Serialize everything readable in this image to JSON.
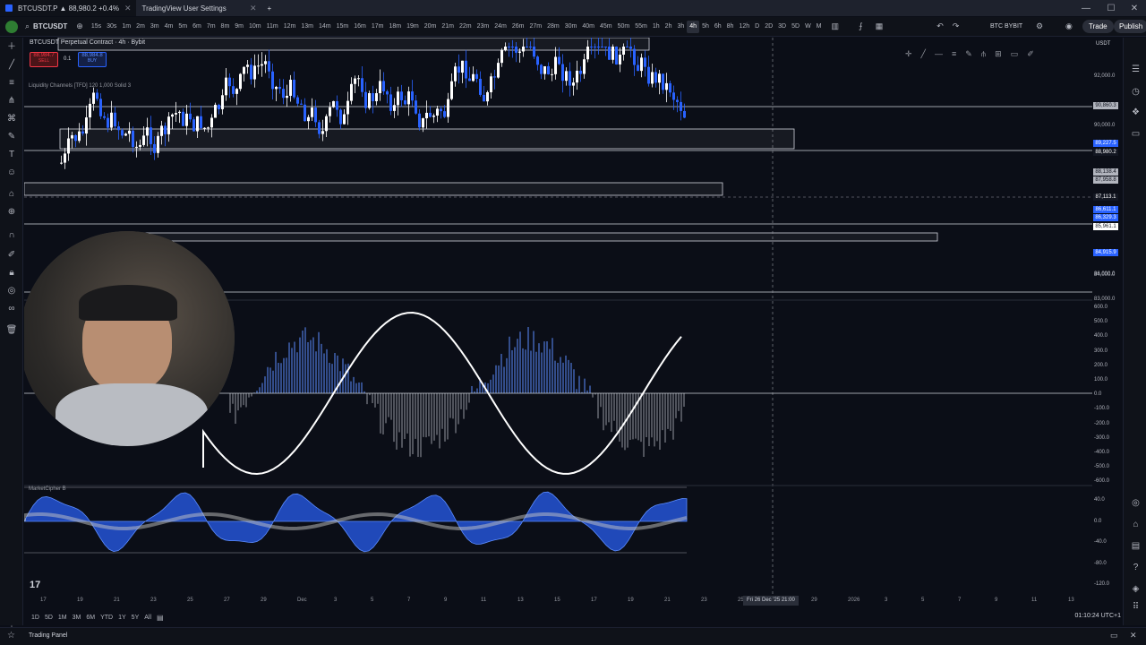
{
  "browser": {
    "tabs": [
      {
        "label": "BTCUSDT.P ▲ 88,980.2 +0.4%",
        "active": true
      },
      {
        "label": "TradingView User Settings",
        "active": false
      }
    ]
  },
  "toolbar": {
    "symbol": "BTCUSDT",
    "timeframes": [
      "15s",
      "30s",
      "1m",
      "2m",
      "3m",
      "4m",
      "5m",
      "6m",
      "7m",
      "8m",
      "9m",
      "10m",
      "11m",
      "12m",
      "13m",
      "14m",
      "15m",
      "16m",
      "17m",
      "18m",
      "19m",
      "20m",
      "21m",
      "22m",
      "23m",
      "24m",
      "26m",
      "27m",
      "28m",
      "30m",
      "40m",
      "45m",
      "50m",
      "55m",
      "1h",
      "2h",
      "3h",
      "4h",
      "5h",
      "6h",
      "8h",
      "12h",
      "D",
      "2D",
      "3D",
      "5D",
      "W",
      "M"
    ],
    "selected_timeframe": "4h",
    "exchange_label": "BTC BYBIT",
    "trade_label": "Trade",
    "publish_label": "Publish"
  },
  "chart": {
    "legend_title": "BTCUSDT Perpetual Contract · 4h · Bybit",
    "sell_price": "88,984.7",
    "sell_label": "SELL",
    "spread": "0.1",
    "buy_price": "88,984.8",
    "buy_label": "BUY",
    "indicator_label": "Liquidity Channels [TFD] 120 1,000 Solid 3",
    "marketcipher_label": "MarketCipher B"
  },
  "price_axis": {
    "labels": [
      "92,000.0",
      "90,000.0",
      "86,000.0",
      "84,000.0",
      "83,000.0"
    ],
    "badges": [
      {
        "text": "90,860.3",
        "color": "#b2b5be"
      },
      {
        "text": "89,227.5",
        "color": "#2962ff"
      },
      {
        "text": "88,980.2",
        "color": "#131722"
      },
      {
        "text": "88,138.4",
        "color": "#b2b5be"
      },
      {
        "text": "87,958.8",
        "color": "#b2b5be"
      },
      {
        "text": "87,113.1",
        "color": "#131722"
      },
      {
        "text": "86,611.1",
        "color": "#2962ff"
      },
      {
        "text": "86,329.3",
        "color": "#2962ff"
      },
      {
        "text": "85,961.1",
        "color": "#ffffff"
      },
      {
        "text": "84,915.9",
        "color": "#2962ff"
      }
    ],
    "osc_labels": [
      "600.0",
      "500.0",
      "400.0",
      "300.0",
      "200.0",
      "100.0",
      "0.0",
      "-100.0",
      "-200.0",
      "-300.0",
      "-400.0",
      "-500.0",
      "-600.0"
    ],
    "mcb_labels": [
      "40.0",
      "0.0",
      "-40.0",
      "-80.0",
      "-120.0"
    ],
    "currency": "USDT"
  },
  "time_axis": {
    "labels": [
      "17",
      "19",
      "21",
      "23",
      "25",
      "27",
      "29",
      "Dec",
      "3",
      "5",
      "7",
      "9",
      "11",
      "13",
      "15",
      "17",
      "19",
      "21",
      "23",
      "25",
      "27",
      "29",
      "2026",
      "3",
      "5",
      "7",
      "9",
      "11",
      "13"
    ],
    "cursor_label": "Fri 26 Dec '25   21:00"
  },
  "bottom": {
    "ranges": [
      "1D",
      "5D",
      "1M",
      "3M",
      "6M",
      "YTD",
      "1Y",
      "5Y",
      "All"
    ],
    "clock": "01:10:24 UTC+1",
    "panel_label": "Trading Panel"
  }
}
